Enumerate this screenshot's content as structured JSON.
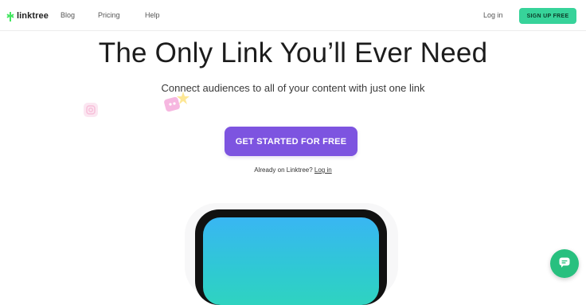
{
  "nav": {
    "logo_text": "linktree",
    "links": [
      "Blog",
      "Pricing",
      "Help"
    ],
    "login": "Log in",
    "signup": "SIGN UP FREE"
  },
  "hero": {
    "title": "The Only Link You’ll Ever Need",
    "subtitle": "Connect audiences to all of your content with just one link",
    "cta": "GET STARTED FOR FREE",
    "already_text": "Already on Linktree?",
    "already_link": "Log in"
  },
  "colors": {
    "signup_bg": "#37d39a",
    "cta_bg": "#7d54e0",
    "chat_bg": "#28c07f",
    "phone_screen_top": "#39b6f3",
    "phone_screen_bottom": "#2fd3c0"
  },
  "icons": {
    "logo": "linktree-logo-icon",
    "instagram": "instagram-icon",
    "chat": "chat-icon"
  }
}
